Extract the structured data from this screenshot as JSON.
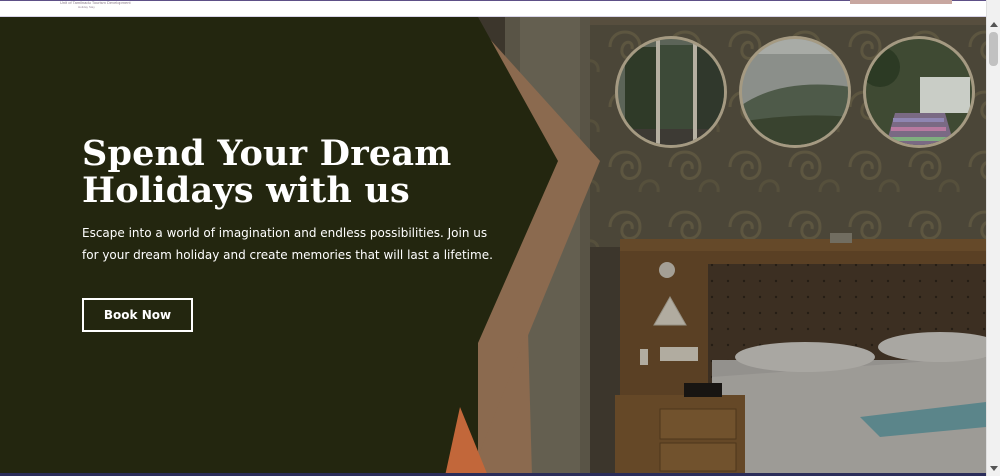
{
  "header": {
    "logo_text": "Unit of Tamilnadu Tourism Development",
    "logo_subtext": "Holiday Stay"
  },
  "hero": {
    "title_line1": "Spend Your Dream",
    "title_line2": "Holidays with us",
    "subtitle": "Escape into a world of imagination and endless possibilities. Join us for your dream holiday and create memories that will last a lifetime.",
    "button_label": "Book Now"
  },
  "colors": {
    "panel_dark": "#23260f",
    "chevron_tan": "#8b6a4f",
    "accent_orange": "#c2673a",
    "text_white": "#ffffff"
  }
}
